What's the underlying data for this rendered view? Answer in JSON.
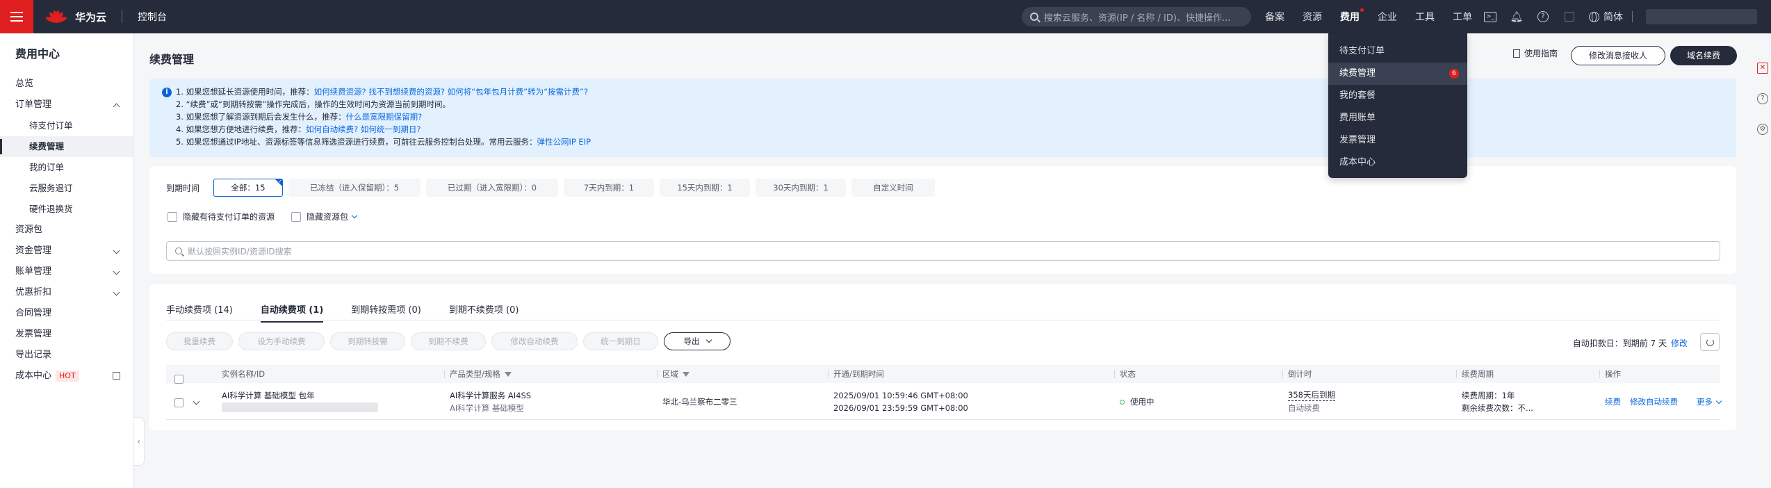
{
  "topbar": {
    "brand": "华为云",
    "console": "控制台",
    "search_placeholder": "搜索云服务、资源(IP / 名称 / ID)、快捷操作...",
    "nav": [
      "备案",
      "资源",
      "费用",
      "企业",
      "工具",
      "工单"
    ],
    "lang": "简体"
  },
  "fee_menu": {
    "items": [
      "待支付订单",
      "续费管理",
      "我的套餐",
      "费用账单",
      "发票管理",
      "成本中心"
    ],
    "badge": "6"
  },
  "sidebar": {
    "title": "费用中心",
    "overview": "总览",
    "order_mgmt": "订单管理",
    "pending_orders": "待支付订单",
    "renewal_mgmt": "续费管理",
    "my_orders": "我的订单",
    "cloud_return": "云服务退订",
    "hw_return": "硬件退换货",
    "package": "资源包",
    "fund_mgmt": "资金管理",
    "bill_mgmt": "账单管理",
    "discount": "优惠折扣",
    "contract": "合同管理",
    "invoice": "发票管理",
    "export": "导出记录",
    "cost_center": "成本中心",
    "hot": "HOT"
  },
  "page": {
    "title": "续费管理",
    "guide": "使用指南",
    "modify_receiver": "修改消息接收人",
    "domain_renew": "域名续费"
  },
  "notice": {
    "l1a": "1. 如果您想延长资源使用时间，推荐：",
    "l1b": "如何续费资源? 找不到想续费的资源? 如何将“包年包月计费”转为“按需计费”?",
    "l2": "2. “续费”或“到期转按需”操作完成后，操作的生效时间为资源当前到期时间。",
    "l3a": "3. 如果您想了解资源到期后会发生什么，推荐：",
    "l3b": "什么是宽限期保留期?",
    "l4a": "4. 如果您想方便地进行续费，推荐：",
    "l4b": "如何自动续费? 如何统一到期日?",
    "l5a": "5. 如果您想通过IP地址、资源标签等信息筛选资源进行续费，可前往云服务控制台处理。常用云服务：",
    "l5b": "弹性公网IP EIP"
  },
  "filter": {
    "label": "到期时间",
    "chips": [
      "全部：15",
      "已冻结（进入保留期）：5",
      "已过期（进入宽限期）：0",
      "7天内到期：1",
      "15天内到期：1",
      "30天内到期：1",
      "自定义时间"
    ],
    "hide_pending": "隐藏有待支付订单的资源",
    "hide_package": "隐藏资源包",
    "search_placeholder": "默认按照实例ID/资源ID搜索"
  },
  "tabs": [
    "手动续费项 (14)",
    "自动续费项 (1)",
    "到期转按需项 (0)",
    "到期不续费项 (0)"
  ],
  "toolbar": {
    "buttons": [
      "批量续费",
      "设为手动续费",
      "到期转按需",
      "到期不续费",
      "修改自动续费",
      "统一到期日"
    ],
    "export": "导出",
    "auto_deduct": "自动扣款日：到期前 7 天",
    "modify": "修改"
  },
  "table": {
    "headers": [
      "实例名称/ID",
      "产品类型/规格",
      "区域",
      "开通/到期时间",
      "状态",
      "倒计时",
      "续费周期",
      "操作"
    ],
    "row": {
      "name": "AI科学计算 基础模型 包年",
      "product": "AI科学计算服务 AI4SS",
      "spec": "AI科学计算 基础模型",
      "region": "华北-乌兰察布二零三",
      "start": "2025/09/01 10:59:46 GMT+08:00",
      "end": "2026/09/01 23:59:59 GMT+08:00",
      "status": "使用中",
      "countdown": "358天后到期",
      "countdown_sub": "自动续费",
      "period": "续费周期：1年",
      "times": "剩余续费次数：不...",
      "op_renew": "续费",
      "op_modify": "修改自动续费",
      "op_more": "更多"
    }
  },
  "colors": {
    "topbar": "#252b3a",
    "brand_red": "#e02020",
    "link": "#0d6ae0",
    "notice_bg": "#e3f0fe"
  }
}
